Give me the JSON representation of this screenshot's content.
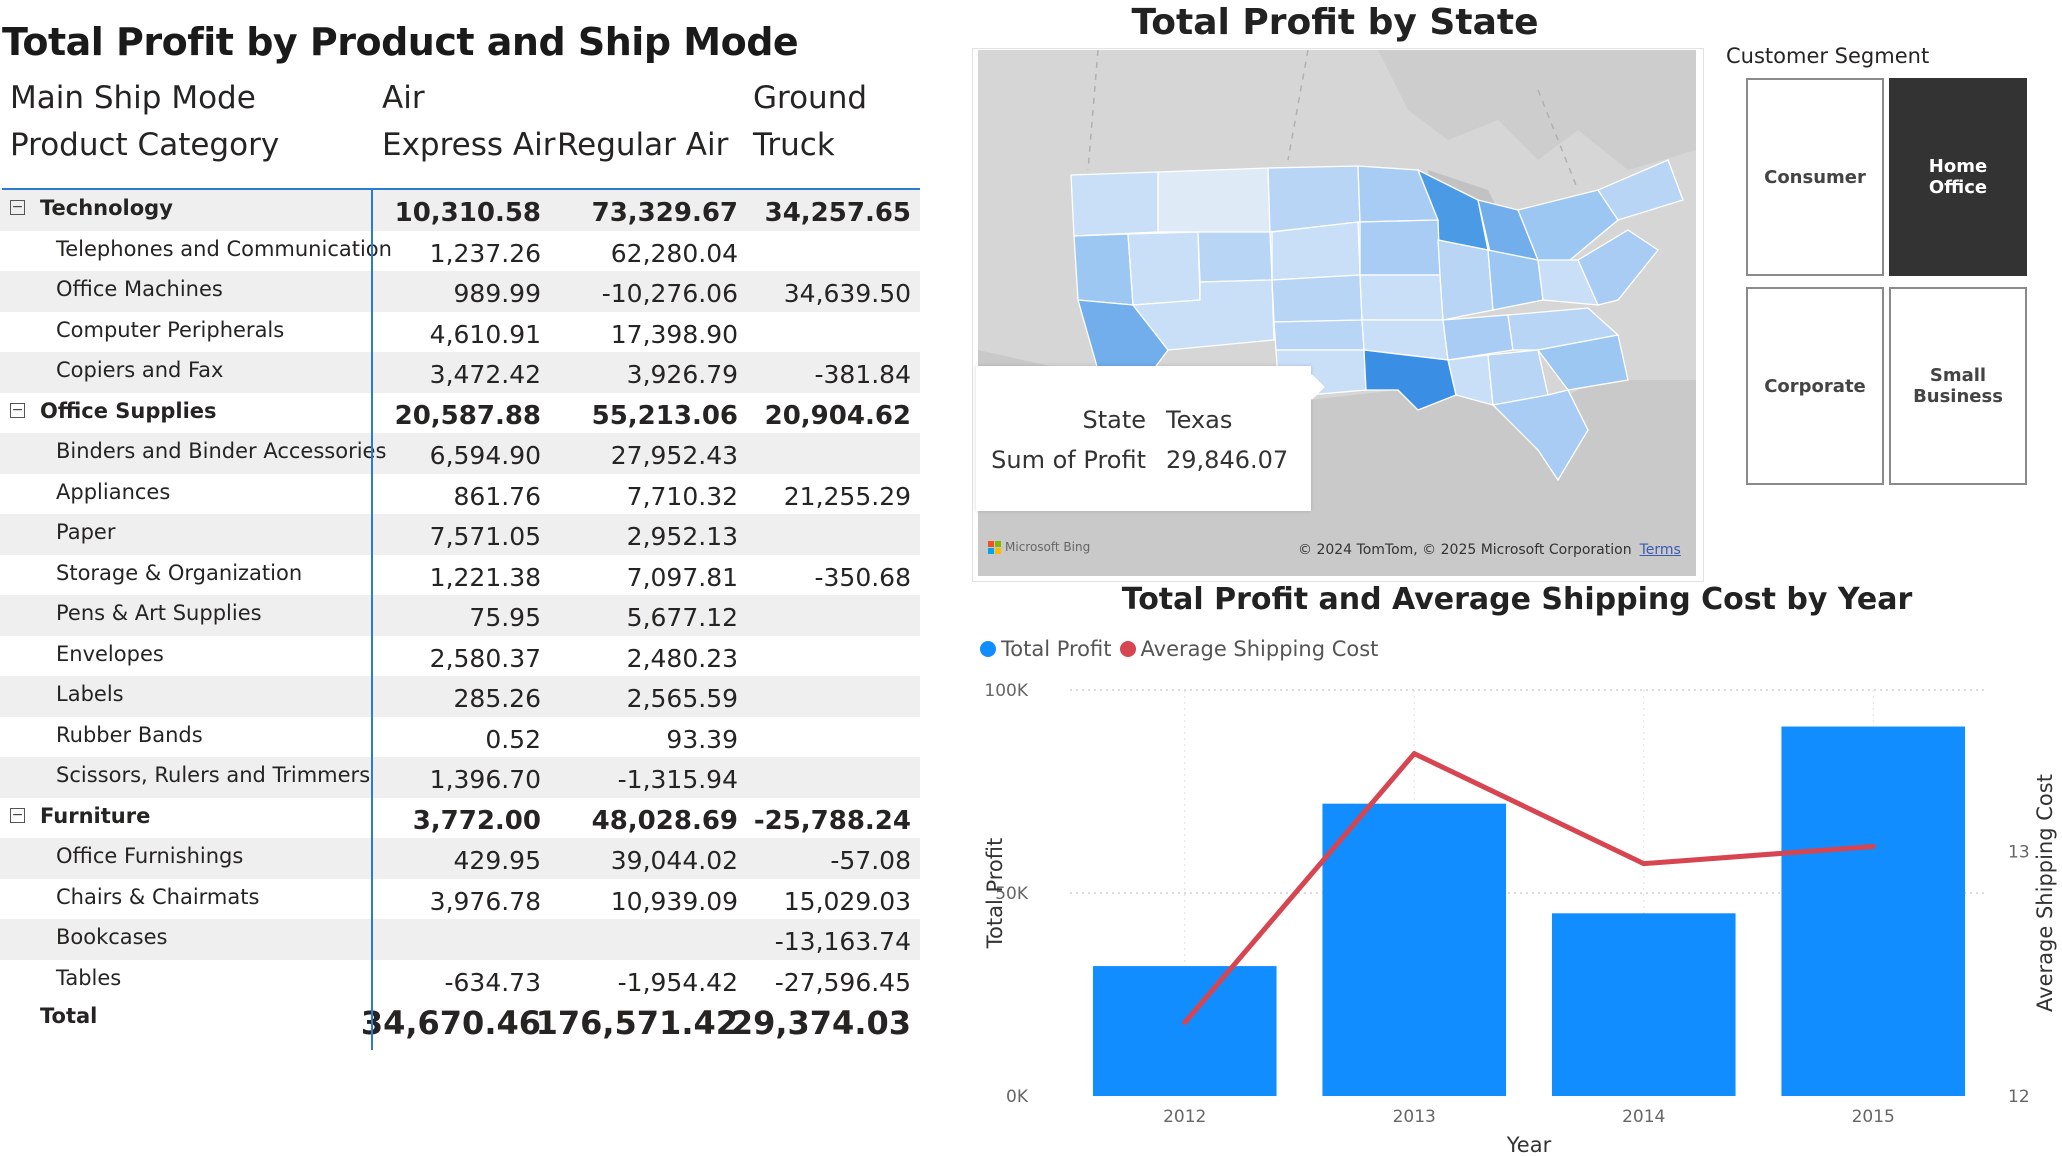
{
  "matrix": {
    "title": "Total Profit by Product and Ship Mode",
    "header": {
      "row1_label": "Main Ship Mode",
      "row2_label": "Product Category",
      "groups": [
        "Air",
        "Ground"
      ],
      "columns": [
        "Express Air",
        "Regular Air",
        "Truck"
      ]
    },
    "toggle_symbol": "⊟",
    "rows": [
      {
        "type": "group",
        "label": "Technology",
        "values": [
          "10,310.58",
          "73,329.67",
          "34,257.65"
        ]
      },
      {
        "type": "child",
        "label": "Telephones and Communication",
        "values": [
          "1,237.26",
          "62,280.04",
          ""
        ]
      },
      {
        "type": "child",
        "label": "Office Machines",
        "values": [
          "989.99",
          "-10,276.06",
          "34,639.50"
        ]
      },
      {
        "type": "child",
        "label": "Computer Peripherals",
        "values": [
          "4,610.91",
          "17,398.90",
          ""
        ]
      },
      {
        "type": "child",
        "label": "Copiers and Fax",
        "values": [
          "3,472.42",
          "3,926.79",
          "-381.84"
        ]
      },
      {
        "type": "group",
        "label": "Office Supplies",
        "values": [
          "20,587.88",
          "55,213.06",
          "20,904.62"
        ]
      },
      {
        "type": "child",
        "label": "Binders and Binder Accessories",
        "values": [
          "6,594.90",
          "27,952.43",
          ""
        ]
      },
      {
        "type": "child",
        "label": "Appliances",
        "values": [
          "861.76",
          "7,710.32",
          "21,255.29"
        ]
      },
      {
        "type": "child",
        "label": "Paper",
        "values": [
          "7,571.05",
          "2,952.13",
          ""
        ]
      },
      {
        "type": "child",
        "label": "Storage & Organization",
        "values": [
          "1,221.38",
          "7,097.81",
          "-350.68"
        ]
      },
      {
        "type": "child",
        "label": "Pens & Art Supplies",
        "values": [
          "75.95",
          "5,677.12",
          ""
        ]
      },
      {
        "type": "child",
        "label": "Envelopes",
        "values": [
          "2,580.37",
          "2,480.23",
          ""
        ]
      },
      {
        "type": "child",
        "label": "Labels",
        "values": [
          "285.26",
          "2,565.59",
          ""
        ]
      },
      {
        "type": "child",
        "label": "Rubber Bands",
        "values": [
          "0.52",
          "93.39",
          ""
        ]
      },
      {
        "type": "child",
        "label": "Scissors, Rulers and Trimmers",
        "values": [
          "1,396.70",
          "-1,315.94",
          ""
        ]
      },
      {
        "type": "group",
        "label": "Furniture",
        "values": [
          "3,772.00",
          "48,028.69",
          "-25,788.24"
        ]
      },
      {
        "type": "child",
        "label": "Office Furnishings",
        "values": [
          "429.95",
          "39,044.02",
          "-57.08"
        ]
      },
      {
        "type": "child",
        "label": "Chairs & Chairmats",
        "values": [
          "3,976.78",
          "10,939.09",
          "15,029.03"
        ]
      },
      {
        "type": "child",
        "label": "Bookcases",
        "values": [
          "",
          "",
          "-13,163.74"
        ]
      },
      {
        "type": "child",
        "label": "Tables",
        "values": [
          "-634.73",
          "-1,954.42",
          "-27,596.45"
        ]
      },
      {
        "type": "total",
        "label": "Total",
        "values": [
          "34,670.46",
          "176,571.42",
          "29,374.03"
        ]
      }
    ]
  },
  "map": {
    "title": "Total Profit by State",
    "tooltip": {
      "state_key": "State",
      "state_value": "Texas",
      "profit_key": "Sum of Profit",
      "profit_value": "29,846.07"
    },
    "logo_text": "Microsoft Bing",
    "attribution": "© 2024 TomTom, © 2025 Microsoft Corporation",
    "terms_link": "Terms",
    "colors": {
      "land": "#d4d4d4",
      "water": "#c8c8c8",
      "light": "#c9dff7",
      "mid": "#9cc7f2",
      "dark": "#4b9ae6"
    }
  },
  "slicer": {
    "title": "Customer Segment",
    "options": [
      {
        "label": "Consumer",
        "selected": false
      },
      {
        "label": "Home Office",
        "selected": true
      },
      {
        "label": "Corporate",
        "selected": false
      },
      {
        "label": "Small Business",
        "selected": false
      }
    ]
  },
  "combo_chart": {
    "title": "Total Profit and Average Shipping Cost by Year",
    "legend": [
      "Total Profit",
      "Average Shipping Cost"
    ],
    "x_title": "Year",
    "y_title": "Total Profit",
    "y2_title": "Average Shipping Cost",
    "y_ticks": [
      "0K",
      "50K",
      "100K"
    ],
    "y2_ticks": [
      "12",
      "13"
    ],
    "colors": {
      "bar": "#118dff",
      "line": "#d64550"
    }
  },
  "chart_data": {
    "type": "bar",
    "categories": [
      "2012",
      "2013",
      "2014",
      "2015"
    ],
    "series": [
      {
        "name": "Total Profit",
        "type": "bar",
        "axis": "left",
        "values": [
          32000,
          72000,
          45000,
          91000
        ]
      },
      {
        "name": "Average Shipping Cost",
        "type": "line",
        "axis": "right",
        "values": [
          12.3,
          13.4,
          12.95,
          13.02
        ]
      }
    ],
    "xlabel": "Year",
    "ylabel": "Total Profit",
    "y2label": "Average Shipping Cost",
    "ylim": [
      0,
      100000
    ],
    "y2lim": [
      12,
      13.66
    ],
    "grid": true,
    "legend": "top-left"
  }
}
